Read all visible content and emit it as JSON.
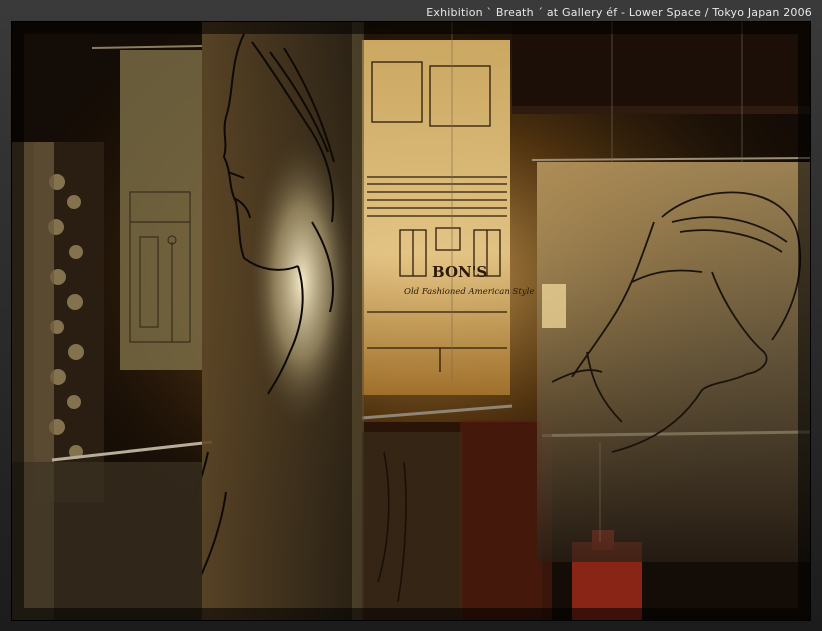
{
  "caption": "Exhibition  ` Breath ´  at  Gallery éf - Lower Space  /  Tokyo Japan  2006",
  "sign_text": "BON'S",
  "sign_subtext": "Old Fashioned American Style",
  "colors": {
    "frame": "#2a2a2a",
    "photo_dark": "#120c06",
    "warm_glow": "#e8c070",
    "amber": "#b07a2a",
    "red": "#b03020"
  }
}
